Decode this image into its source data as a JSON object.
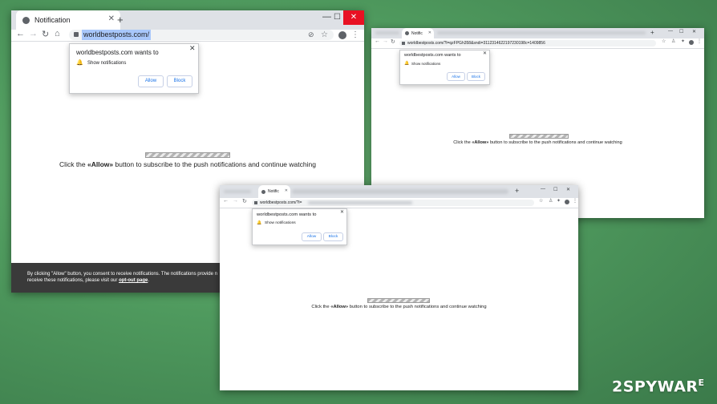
{
  "browser_large": {
    "tab_title": "Notification",
    "url": "worldbestposts.com/",
    "popup": {
      "site_wants_to": "worldbestposts.com wants to",
      "permission": "Show notifications",
      "allow_label": "Allow",
      "block_label": "Block"
    },
    "message_prefix": "Click the ",
    "message_allow": "«Allow»",
    "message_suffix": " button to subscribe to the push notifications and continue watching",
    "consent_line1": "By clicking \"Allow\" button, you consent to receive notifications. The notifications provide n",
    "consent_line2_prefix": "receive these notifications, please visit our ",
    "consent_link": "opt-out page",
    "consent_line2_suffix": "."
  },
  "browser_right": {
    "tab_title": "Notific",
    "url": "worldbestposts.com/?l=qzFPGh358&sndi=3112314622197230198c=1409856",
    "popup": {
      "site_wants_to": "worldbestposts.com wants to",
      "permission": "Show notifications",
      "allow_label": "Allow",
      "block_label": "Block"
    },
    "message_prefix": "Click the ",
    "message_allow": "«Allow»",
    "message_suffix": " button to subscribe to the push notifications and continue watching"
  },
  "browser_front": {
    "tab_title": "Notific",
    "url": "worldbestposts.com/?l=",
    "popup": {
      "site_wants_to": "worldbestposts.com wants to",
      "permission": "Show notifications",
      "allow_label": "Allow",
      "block_label": "Block"
    },
    "message_prefix": "Click the ",
    "message_allow": "«Allow»",
    "message_suffix": " button to subscribe to the push notifications and continue watching"
  },
  "watermark": {
    "brand": "2SPYWAR",
    "sup": "E"
  },
  "colors": {
    "background": "#4f9a5e",
    "tabstrip": "#dee1e6",
    "accent_blue": "#1a73e8",
    "consent_bar": "#3a3a3a"
  }
}
